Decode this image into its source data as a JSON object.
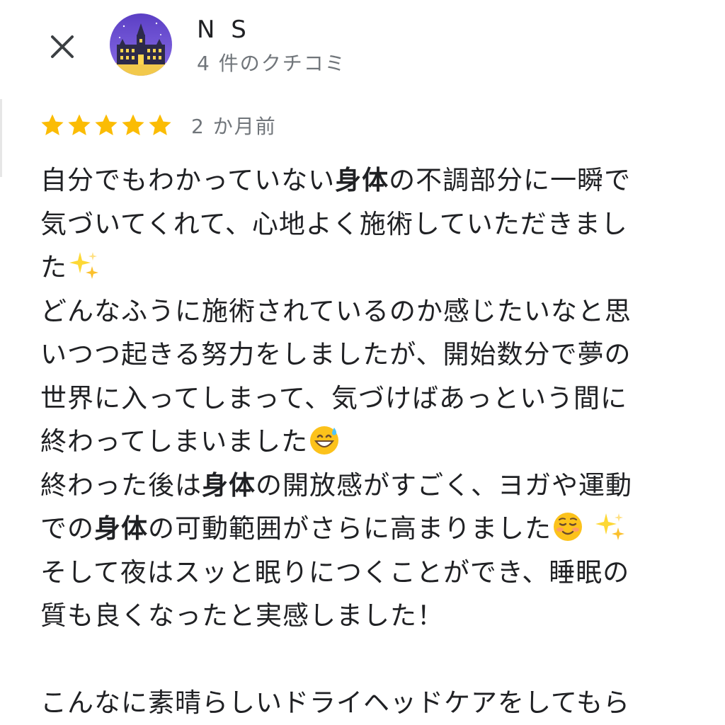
{
  "header": {
    "close_icon": "close-icon",
    "avatar_icon": "castle-night-avatar",
    "reviewer_name": "N S",
    "review_count": "4 件のクチコミ"
  },
  "review": {
    "rating": 5,
    "rating_max": 5,
    "star_color": "#fbbc04",
    "date": "2 か月前",
    "lines": [
      [
        {
          "t": "自分でもわかっていない"
        },
        {
          "t": "身体",
          "b": true
        },
        {
          "t": "の不調部分に一瞬で"
        }
      ],
      [
        {
          "t": "気づいてくれて、心地よく施術していただきまし"
        }
      ],
      [
        {
          "t": "た"
        },
        {
          "e": "sparkles-emoji"
        }
      ],
      [
        {
          "t": "どんなふうに施術されているのか感じたいなと思"
        }
      ],
      [
        {
          "t": "いつつ起きる努力をしましたが、開始数分で夢の"
        }
      ],
      [
        {
          "t": "世界に入ってしまって、気づけばあっという間に"
        }
      ],
      [
        {
          "t": "終わってしまいました"
        },
        {
          "e": "grinning-sweat-emoji"
        }
      ],
      [
        {
          "t": "終わった後は"
        },
        {
          "t": "身体",
          "b": true
        },
        {
          "t": "の開放感がすごく、ヨガや運動"
        }
      ],
      [
        {
          "t": "での"
        },
        {
          "t": "身体",
          "b": true
        },
        {
          "t": "の可動範囲がさらに高まりました"
        },
        {
          "e": "smiling-face-emoji"
        },
        {
          "t": " "
        },
        {
          "e": "sparkles-emoji"
        }
      ],
      [
        {
          "t": "そして夜はスッと眠りにつくことができ、睡眠の"
        }
      ],
      [
        {
          "t": "質も良くなったと実感しました！"
        }
      ],
      [
        {
          "t": ""
        }
      ],
      [
        {
          "t": "こんなに素晴らしいドライヘッドケアをしてもら"
        }
      ]
    ]
  }
}
